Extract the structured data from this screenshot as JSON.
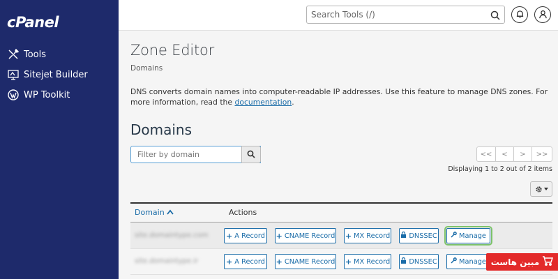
{
  "app": {
    "logo": "cPanel"
  },
  "sidebar": {
    "items": [
      {
        "label": "Tools",
        "icon": "tools-icon"
      },
      {
        "label": "Sitejet Builder",
        "icon": "sitejet-icon"
      },
      {
        "label": "WP Toolkit",
        "icon": "wordpress-icon"
      }
    ]
  },
  "topbar": {
    "search_placeholder": "Search Tools (/)",
    "notifications_icon": "bell-icon",
    "user_icon": "user-icon"
  },
  "page": {
    "title": "Zone Editor",
    "breadcrumb": "Domains",
    "description_prefix": "DNS converts domain names into computer-readable IP addresses. Use this feature to manage DNS zones. For more information, read the ",
    "description_link": "documentation",
    "description_suffix": ".",
    "section_title": "Domains"
  },
  "filter": {
    "placeholder": "Filter by domain"
  },
  "pagination": {
    "first": "<<",
    "prev": "<",
    "next": ">",
    "last": ">>",
    "info": "Displaying 1 to 2 out of 2 items"
  },
  "table": {
    "headers": {
      "domain": "Domain",
      "actions": "Actions"
    },
    "rows": [
      {
        "domain": "site.domaintype.com"
      },
      {
        "domain": "site.domaintype.ir"
      }
    ],
    "actions": {
      "a_record": "A Record",
      "cname_record": "CNAME Record",
      "mx_record": "MX Record",
      "dnssec": "DNSSEC",
      "manage": "Manage"
    }
  },
  "watermark": {
    "text": "مبين هاست"
  },
  "colors": {
    "sidebar_bg": "#1e2a6b",
    "link": "#1a6ca8",
    "highlight": "#7ec36b",
    "watermark_bg": "#e32a2a"
  }
}
